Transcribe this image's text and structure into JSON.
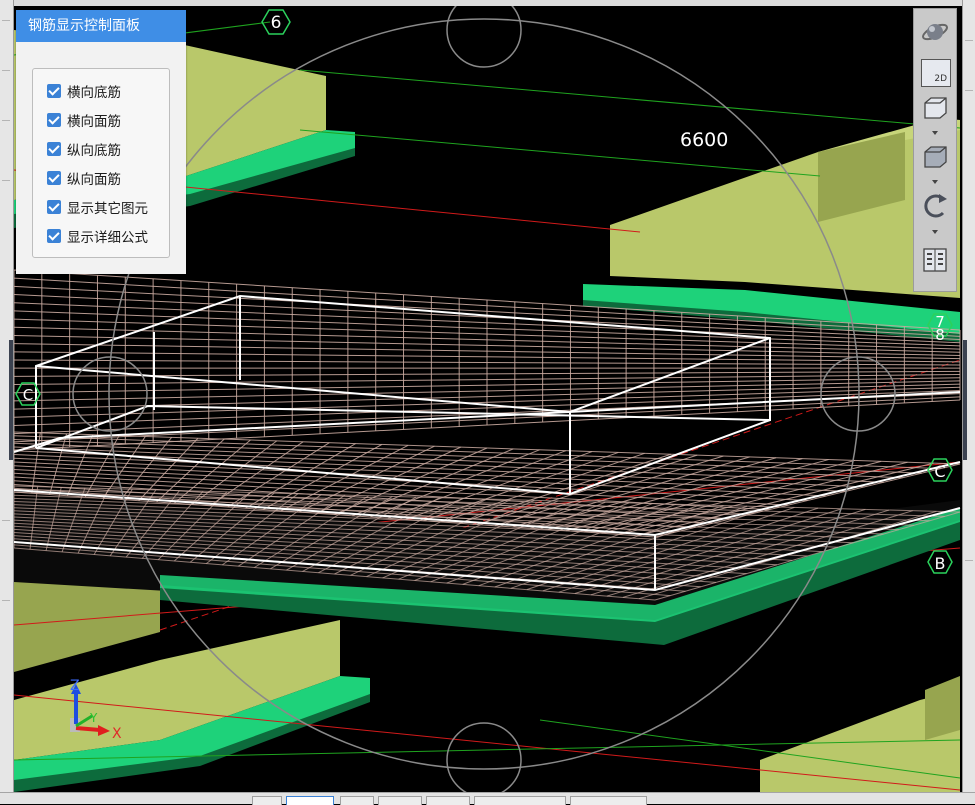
{
  "control_panel": {
    "title": "钢筋显示控制面板",
    "options": [
      {
        "label": "横向底筋",
        "checked": true
      },
      {
        "label": "横向面筋",
        "checked": true
      },
      {
        "label": "纵向底筋",
        "checked": true
      },
      {
        "label": "纵向面筋",
        "checked": true
      },
      {
        "label": "显示其它图元",
        "checked": true
      },
      {
        "label": "显示详细公式",
        "checked": true
      }
    ]
  },
  "toolbar": {
    "items": [
      "orbit-icon",
      "2d-view-icon",
      "3d-box-view-icon",
      "3d-solid-view-icon",
      "rotate-icon",
      "layout-icon"
    ],
    "view_2d_label": "2D"
  },
  "scene": {
    "dimension_label": "6600",
    "axis_labels": {
      "axis_6": "6",
      "axis_7": "7",
      "axis_8": "8",
      "axis_c_left": "C",
      "axis_c_right": "C",
      "axis_b": "B"
    },
    "gizmo": {
      "x": "X",
      "y": "Y",
      "z": "Z"
    },
    "colors": {
      "background": "#000000",
      "beam_top": "#b9c86a",
      "beam_side": "#97a54f",
      "slab_edge": "#1ed27a",
      "slab_fill": "#0d6b3c",
      "rebar": "#c9aaa0",
      "outline": "#ffffff",
      "axis_red": "#d11a1a",
      "axis_green": "#1fa31f",
      "panel_header": "#3f8ee6"
    }
  }
}
